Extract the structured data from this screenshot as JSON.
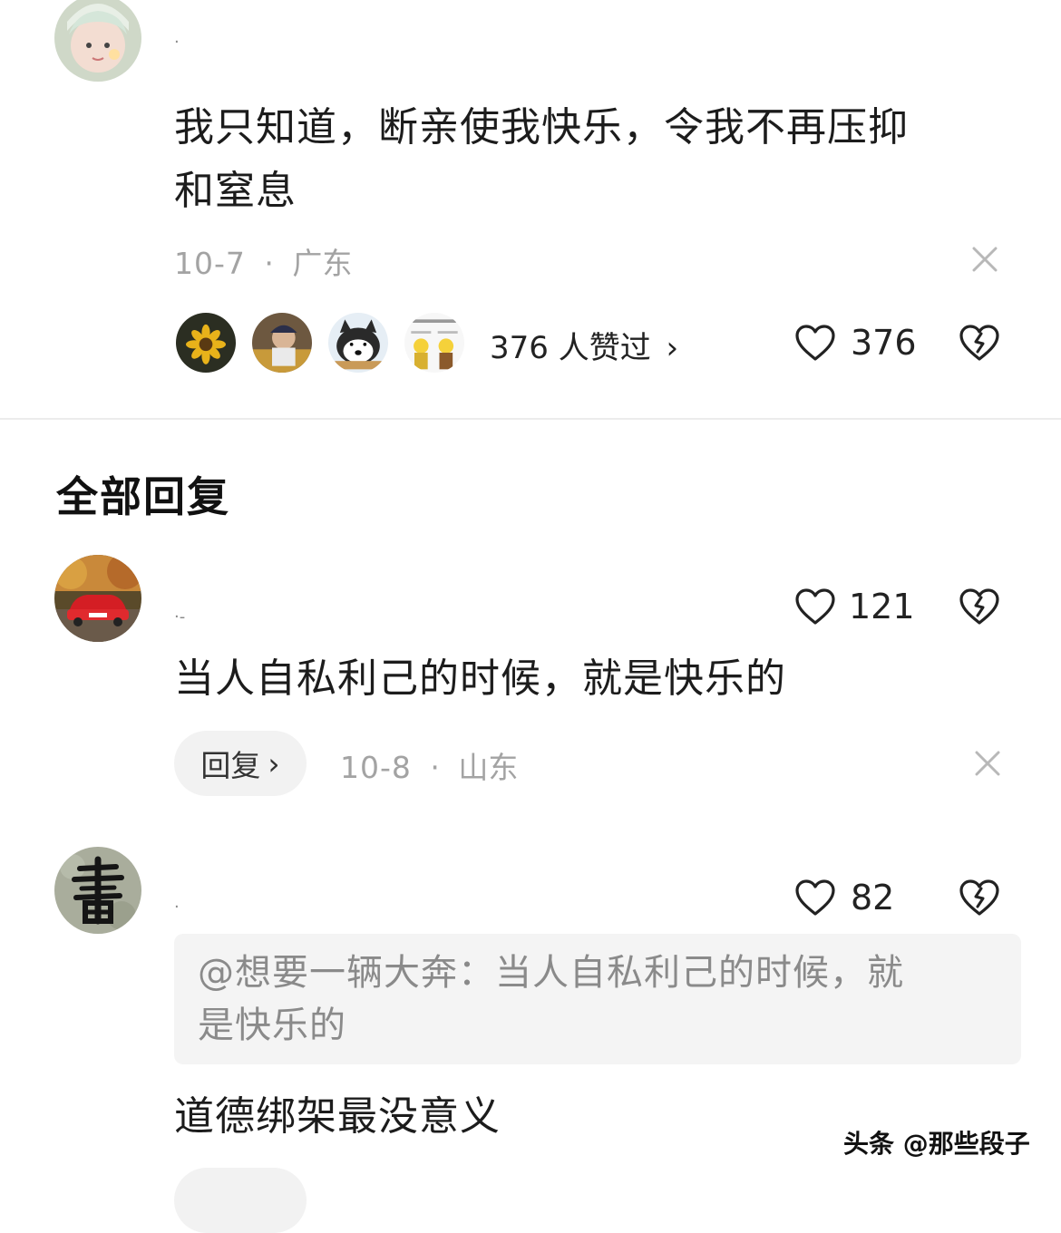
{
  "top_comment": {
    "username": "·",
    "content_line1": "我只知道，断亲使我快乐，令我不再压抑",
    "content_line2": "和窒息",
    "date": "10-7",
    "separator": "·",
    "location": "广东",
    "likers_text": "376 人赞过",
    "likers_chevron": "›",
    "like_count": "376"
  },
  "section": {
    "title": "全部回复"
  },
  "replies": [
    {
      "username": "·-",
      "like_count": "121",
      "content": "当人自私利己的时候，就是快乐的",
      "reply_label": "回复",
      "reply_chevron": "›",
      "date": "10-8",
      "separator": "·",
      "location": "山东"
    },
    {
      "username": "·",
      "like_count": "82",
      "quote_line1": "@想要一辆大奔：当人自私利己的时候，就",
      "quote_line2": "是快乐的",
      "content": "道德绑架最没意义"
    }
  ],
  "watermark": "头条 @那些段子",
  "colors": {
    "text": "#1c1c1c",
    "meta": "#a3a3a3",
    "divider": "#ececec",
    "pill": "#f2f2f2"
  }
}
